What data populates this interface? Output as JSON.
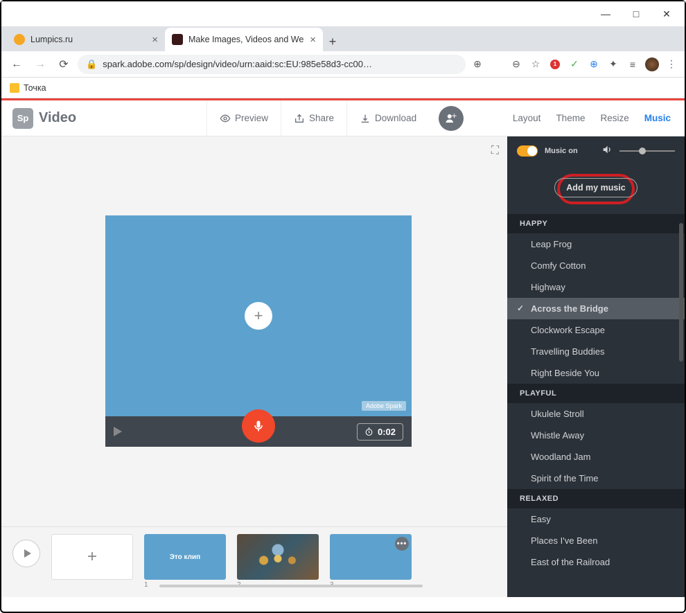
{
  "window": {
    "min": "—",
    "max": "□",
    "close": "✕"
  },
  "tabs": [
    {
      "title": "Lumpics.ru",
      "active": false
    },
    {
      "title": "Make Images, Videos and Web S",
      "active": true
    }
  ],
  "address": {
    "url": "spark.adobe.com/sp/design/video/urn:aaid:sc:EU:985e58d3-cc00…"
  },
  "bookmark": {
    "label": "Точка"
  },
  "app": {
    "logo_badge": "Sp",
    "logo_text": "Video",
    "preview": "Preview",
    "share": "Share",
    "download": "Download",
    "tabs": {
      "layout": "Layout",
      "theme": "Theme",
      "resize": "Resize",
      "music": "Music"
    }
  },
  "canvas": {
    "watermark": "Adobe Spark",
    "duration": "0:02"
  },
  "timeline": {
    "thumb2_text": "Это клип",
    "n1": "1",
    "n2": "2",
    "n3": "3"
  },
  "music": {
    "on_label": "Music on",
    "add_btn": "Add my music",
    "categories": [
      {
        "name": "HAPPY",
        "tracks": [
          {
            "title": "Leap Frog"
          },
          {
            "title": "Comfy Cotton"
          },
          {
            "title": "Highway"
          },
          {
            "title": "Across the Bridge",
            "selected": true
          },
          {
            "title": "Clockwork Escape"
          },
          {
            "title": "Travelling Buddies"
          },
          {
            "title": "Right Beside You"
          }
        ]
      },
      {
        "name": "PLAYFUL",
        "tracks": [
          {
            "title": "Ukulele Stroll"
          },
          {
            "title": "Whistle Away"
          },
          {
            "title": "Woodland Jam"
          },
          {
            "title": "Spirit of the Time"
          }
        ]
      },
      {
        "name": "RELAXED",
        "tracks": [
          {
            "title": "Easy"
          },
          {
            "title": "Places I've Been"
          },
          {
            "title": "East of the Railroad"
          }
        ]
      }
    ]
  }
}
